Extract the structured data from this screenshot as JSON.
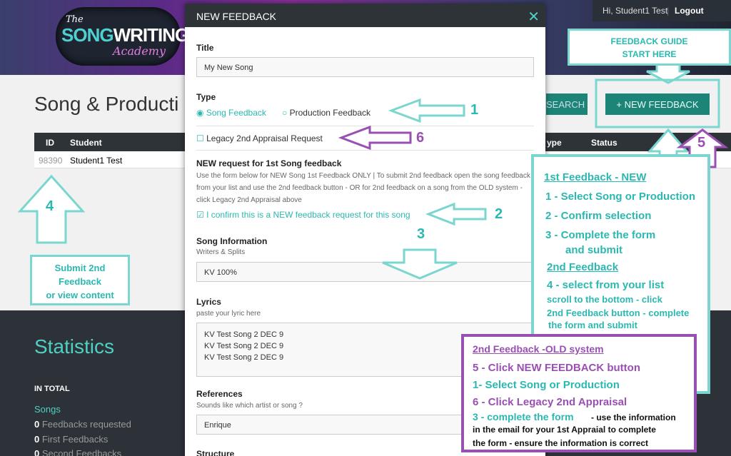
{
  "header": {
    "greeting": "Hi, Student1 Test",
    "separator": "|",
    "logout": "Logout",
    "logo": {
      "the": "The",
      "song": "SONG",
      "writing": "WRITING",
      "academy": "Academy"
    }
  },
  "page": {
    "title": "Song & Producti",
    "search_label": "SEARCH",
    "new_feedback_label": "+ NEW FEEDBACK"
  },
  "table": {
    "columns": [
      "ID",
      "Student",
      "ype",
      "Status"
    ],
    "rows": [
      {
        "id": "98390",
        "student": "Student1 Test"
      }
    ]
  },
  "stats": {
    "title": "Statistics",
    "in_total": "IN TOTAL",
    "songs": "Songs",
    "items": [
      {
        "count": "0",
        "label": "Feedbacks requested"
      },
      {
        "count": "0",
        "label": "First Feedbacks"
      },
      {
        "count": "0",
        "label": "Second Feedbacks"
      }
    ]
  },
  "modal": {
    "title": "NEW FEEDBACK",
    "close": "✕",
    "title_label": "Title",
    "title_value": "My New Song",
    "type_label": "Type",
    "song_feedback": "Song Feedback",
    "production_feedback": "Production Feedback",
    "legacy": "Legacy 2nd Appraisal Request",
    "new_request_heading": "NEW request for 1st Song feedback",
    "new_request_text": "Use the form below for NEW Song 1st Feedback ONLY | To submit 2nd feedback open the song feedback from your list and use the 2nd feedback button - OR for 2nd feedback on a song from the OLD system - click Legacy 2nd Appraisal above",
    "confirm": "I confirm this is a NEW feedback request for this song",
    "song_info_label": "Song Information",
    "song_info_sub": "Writers & Splits",
    "song_info_value": "KV 100%",
    "lyrics_label": "Lyrics",
    "lyrics_sub": "paste your lyric here",
    "lyrics_lines": [
      "KV Test Song 2 DEC 9",
      "KV Test Song 2 DEC 9",
      "KV Test Song 2 DEC 9"
    ],
    "references_label": "References",
    "references_sub": "Sounds like which artist or song ?",
    "references_value": "Enrique",
    "structure_label": "Structure"
  },
  "annotations": {
    "guide_top": "FEEDBACK GUIDE",
    "guide_top2": "START HERE",
    "n1": "1",
    "n2": "2",
    "n3": "3",
    "n4": "4",
    "n5": "5",
    "n6": "6",
    "submit_box": [
      "Submit 2nd",
      "Feedback",
      "or view content"
    ],
    "guide": [
      "1st Feedback - NEW",
      "1 - Select Song or Production",
      "2 - Confirm selection",
      "3 - Complete the form",
      "and submit",
      "2nd Feedback",
      "4 - select from your list",
      "scroll to the bottom - click",
      "2nd Feedback button - complete",
      "the form and submit"
    ],
    "old": [
      "2nd Feedback -OLD system",
      "5 - Click NEW FEEDBACK button",
      "1- Select Song or Production",
      "6 - Click Legacy 2nd Appraisal",
      "3 - complete the form",
      "- use the information",
      "in the email for your 1st Appraial to complete",
      "the form - ensure the information is correct"
    ]
  },
  "colors": {
    "teal": "#2ab8b0",
    "purple": "#9a4fb3",
    "button": "#1d8478"
  }
}
